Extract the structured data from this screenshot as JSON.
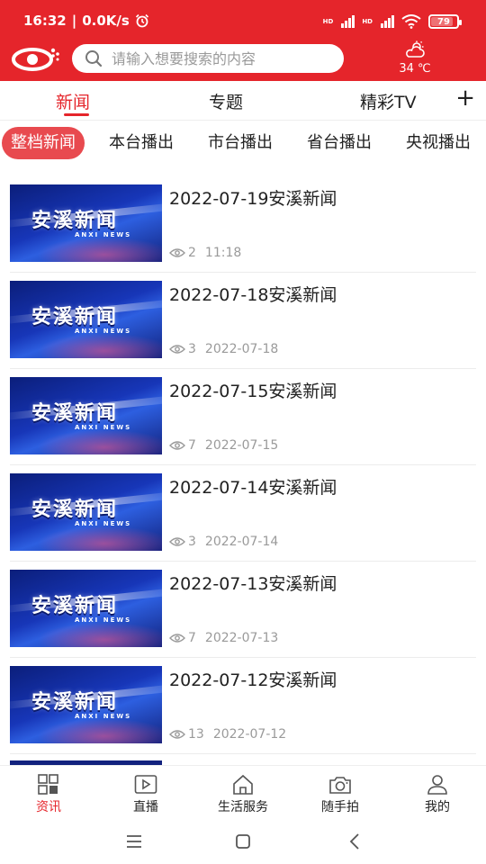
{
  "status_bar": {
    "time": "16:32",
    "speed": "0.0K/s",
    "battery": "79",
    "battery_level": 0.79
  },
  "header": {
    "search_placeholder": "请输入想要搜索的内容",
    "weather_temp": "34 ℃"
  },
  "tabs": {
    "news": "新闻",
    "topics": "专题",
    "tv": "精彩TV",
    "add": "+"
  },
  "subtabs": [
    "整档新闻",
    "本台播出",
    "市台播出",
    "省台播出",
    "央视播出"
  ],
  "thumbnail": {
    "title": "安溪新闻",
    "subtitle": "ANXI NEWS"
  },
  "news": [
    {
      "title": "2022-07-19安溪新闻",
      "views": "2",
      "time": "11:18"
    },
    {
      "title": "2022-07-18安溪新闻",
      "views": "3",
      "time": "2022-07-18"
    },
    {
      "title": "2022-07-15安溪新闻",
      "views": "7",
      "time": "2022-07-15"
    },
    {
      "title": "2022-07-14安溪新闻",
      "views": "3",
      "time": "2022-07-14"
    },
    {
      "title": "2022-07-13安溪新闻",
      "views": "7",
      "time": "2022-07-13"
    },
    {
      "title": "2022-07-12安溪新闻",
      "views": "13",
      "time": "2022-07-12"
    }
  ],
  "bottom_nav": [
    {
      "label": "资讯",
      "icon": "grid-icon"
    },
    {
      "label": "直播",
      "icon": "play-icon"
    },
    {
      "label": "生活服务",
      "icon": "home-icon"
    },
    {
      "label": "随手拍",
      "icon": "camera-icon"
    },
    {
      "label": "我的",
      "icon": "user-icon"
    }
  ],
  "colors": {
    "brand_red": "#e5252b",
    "chip_red": "#e84a4f",
    "meta_gray": "#9a9a9a"
  }
}
